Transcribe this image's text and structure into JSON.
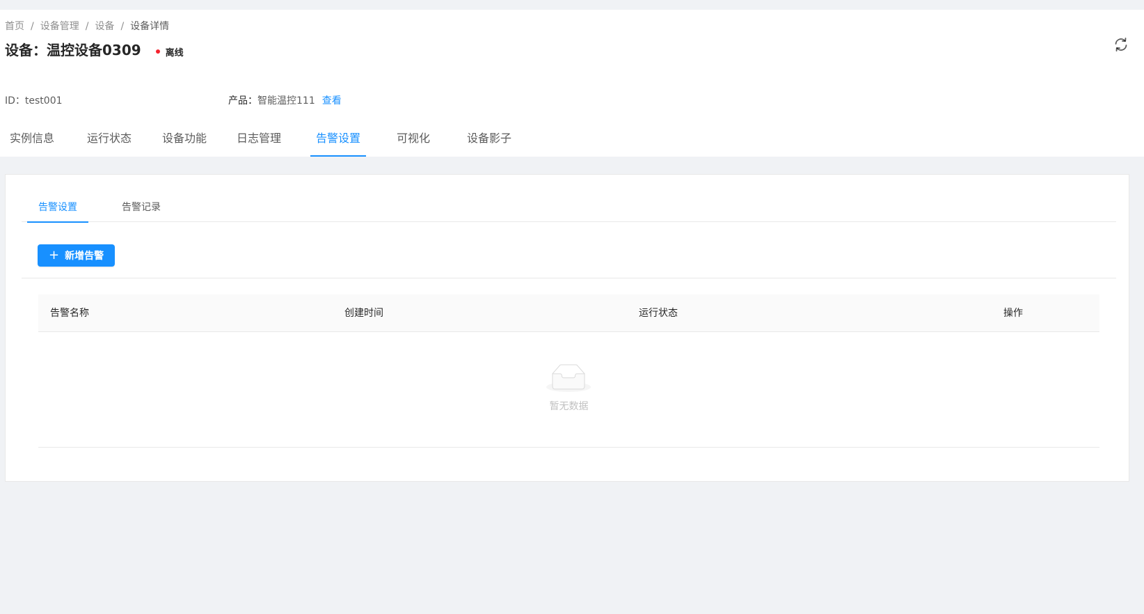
{
  "breadcrumb": {
    "items": [
      "首页",
      "设备管理",
      "设备",
      "设备详情"
    ],
    "separator": "/"
  },
  "device": {
    "title": "设备：温控设备0309",
    "status": "离线",
    "status_color": "#f5222d",
    "id_label": "ID：test001",
    "product_label": "产品：",
    "product_value": "智能温控111",
    "product_link": "查看"
  },
  "header": {
    "refresh_icon": "refresh-icon"
  },
  "tabs": [
    {
      "label": "实例信息",
      "active": false
    },
    {
      "label": "运行状态",
      "active": false
    },
    {
      "label": "设备功能",
      "active": false
    },
    {
      "label": "日志管理",
      "active": false
    },
    {
      "label": "告警设置",
      "active": true
    },
    {
      "label": "可视化",
      "active": false
    },
    {
      "label": "设备影子",
      "active": false
    }
  ],
  "subtabs": [
    {
      "label": "告警设置",
      "active": true
    },
    {
      "label": "告警记录",
      "active": false
    }
  ],
  "toolbar": {
    "add_label": "新增告警",
    "add_icon": "plus-icon"
  },
  "table": {
    "columns": [
      "告警名称",
      "创建时间",
      "运行状态",
      "操作"
    ],
    "rows": [],
    "empty_text": "暂无数据",
    "empty_icon": "inbox-icon"
  },
  "colors": {
    "primary": "#1890ff",
    "background": "#f0f2f5",
    "offline": "#f5222d"
  }
}
